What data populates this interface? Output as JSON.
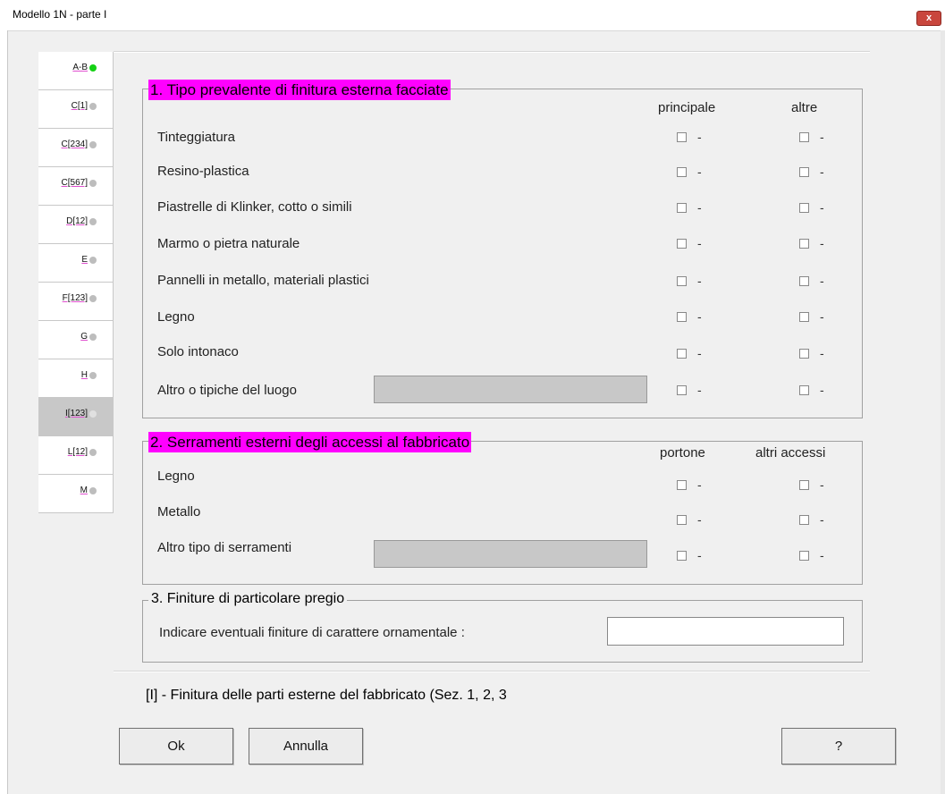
{
  "window": {
    "title": "Modello 1N  -  parte I",
    "close_glyph": "x"
  },
  "tabs": [
    {
      "label": "A-B",
      "dot": "green"
    },
    {
      "label": "C[1]",
      "dot": "gray"
    },
    {
      "label": "C[234]",
      "dot": "gray"
    },
    {
      "label": "C[567]",
      "dot": "gray"
    },
    {
      "label": "D[12]",
      "dot": "gray"
    },
    {
      "label": "E",
      "dot": "gray"
    },
    {
      "label": "F[123]",
      "dot": "gray"
    },
    {
      "label": "G",
      "dot": "gray"
    },
    {
      "label": "H",
      "dot": "gray"
    },
    {
      "label": "I[123]",
      "dot": "white",
      "active": true
    },
    {
      "label": "L[12]",
      "dot": "gray"
    },
    {
      "label": "M",
      "dot": "gray"
    }
  ],
  "section1": {
    "title": "1. Tipo prevalente di finitura esterna facciate",
    "col_main": "principale",
    "col_other": "altre",
    "rows": [
      "Tinteggiatura",
      "Resino-plastica",
      "Piastrelle di Klinker, cotto o simili",
      "Marmo o pietra naturale",
      "Pannelli in metallo, materiali plastici",
      "Legno",
      "Solo intonaco",
      "Altro o tipiche del luogo"
    ],
    "other_input_value": ""
  },
  "section2": {
    "title": "2. Serramenti esterni degli accessi al fabbricato",
    "col_main": "portone",
    "col_other": "altri accessi",
    "rows": [
      "Legno",
      "Metallo",
      "Altro tipo di serramenti"
    ],
    "other_input_value": ""
  },
  "section3": {
    "title": "3. Finiture di particolare pregio",
    "label": "Indicare eventuali finiture di carattere ornamentale :",
    "input_value": ""
  },
  "checkbox_dash": "-",
  "status_text": "[I] - Finitura delle parti esterne del fabbricato (Sez. 1, 2, 3",
  "buttons": {
    "ok": "Ok",
    "cancel": "Annulla",
    "help": "?"
  },
  "colors": {
    "section_highlight": "#ff00ff",
    "complete_dot": "#14d114",
    "incomplete_dot": "#bdbdbd"
  }
}
